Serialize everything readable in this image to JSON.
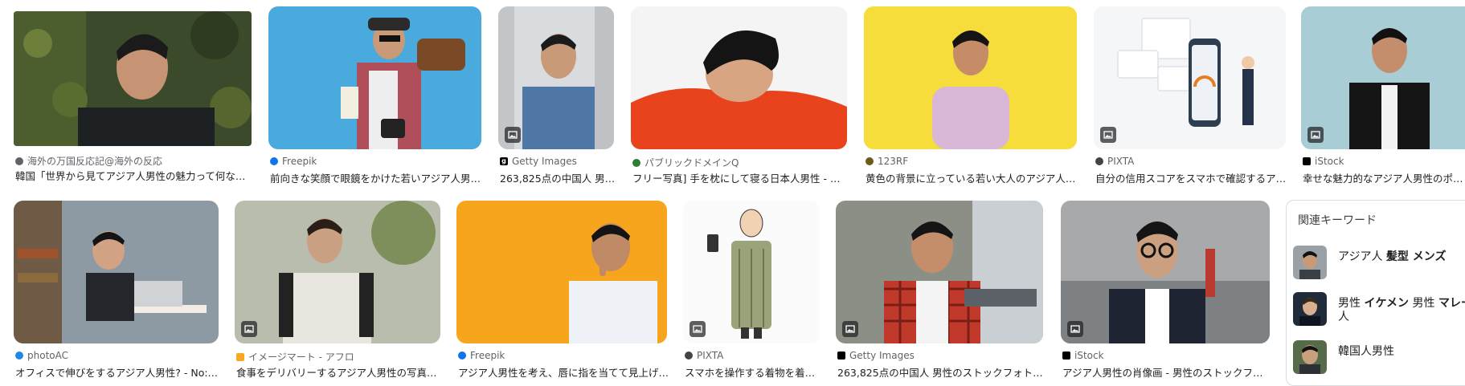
{
  "results": [
    {
      "source": "海外の万国反応記@海外の反応",
      "title": "韓国「世界から見てアジア人男性の魅力って何なの…",
      "favicon_color": "#5f6368",
      "icon": "globe-favicon-icon",
      "badge": false
    },
    {
      "source": "Freepik",
      "title": "前向きな笑顔で眼鏡をかけた若いアジア人男…",
      "favicon_color": "#1273eb",
      "icon": "freepik-favicon-icon",
      "badge": false
    },
    {
      "source": "Getty Images",
      "title": "263,825点の中国人 男…",
      "favicon_color": "#000000",
      "icon": "getty-favicon-icon",
      "badge": true
    },
    {
      "source": "パブリックドメインQ",
      "title": "フリー写真] 手を枕にして寝る日本人男性 - パ…",
      "favicon_color": "#2e7d32",
      "icon": "pdq-favicon-icon",
      "badge": false
    },
    {
      "source": "123RF",
      "title": "黄色の背景に立っている若い大人のアジア人…",
      "favicon_color": "#6d5b1c",
      "icon": "123rf-favicon-icon",
      "badge": false
    },
    {
      "source": "PIXTA",
      "title": "自分の信用スコアをスマホで確認するア…",
      "favicon_color": "#444444",
      "icon": "pixta-favicon-icon",
      "badge": true
    },
    {
      "source": "iStock",
      "title": "幸せな魅力的なアジア人男性のポート…",
      "favicon_color": "#000000",
      "icon": "istock-favicon-icon",
      "badge": true
    },
    {
      "source": "photoAC",
      "title": "オフィスで伸びをするアジア人男性? - No:…",
      "favicon_color": "#1e88e5",
      "icon": "photoac-favicon-icon",
      "badge": false
    },
    {
      "source": "イメージマート - アフロ",
      "title": "食事をデリバリーするアジア人男性の写真…",
      "favicon_color": "#f9a825",
      "icon": "imagemart-favicon-icon",
      "badge": true
    },
    {
      "source": "Freepik",
      "title": "アジア人男性を考え、唇に指を当てて見上げ…",
      "favicon_color": "#1273eb",
      "icon": "freepik-favicon-icon",
      "badge": false
    },
    {
      "source": "PIXTA",
      "title": "スマホを操作する着物を着…",
      "favicon_color": "#444444",
      "icon": "pixta-favicon-icon",
      "badge": true
    },
    {
      "source": "Getty Images",
      "title": "263,825点の中国人 男性のストックフォト…",
      "favicon_color": "#000000",
      "icon": "getty-favicon-icon",
      "badge": true
    },
    {
      "source": "iStock",
      "title": "アジア人男性の肖像画 - 男性のストックフォ…",
      "favicon_color": "#000000",
      "icon": "istock-favicon-icon",
      "badge": true
    }
  ],
  "related": {
    "heading": "関連キーワード",
    "items": [
      {
        "plain": "アジア人 ",
        "bold": "髪型 メンズ"
      },
      {
        "plain": "男性 ",
        "bold": "イケメン",
        "plain2": " 男性 ",
        "bold2": "マレー",
        "line2": "人"
      },
      {
        "plain": "韓国人男性",
        "bold": ""
      }
    ]
  },
  "colors": {
    "accent_yellow": "#f6dd3b",
    "accent_orange": "#f7a51c",
    "accent_blue": "#4aa9dd"
  }
}
